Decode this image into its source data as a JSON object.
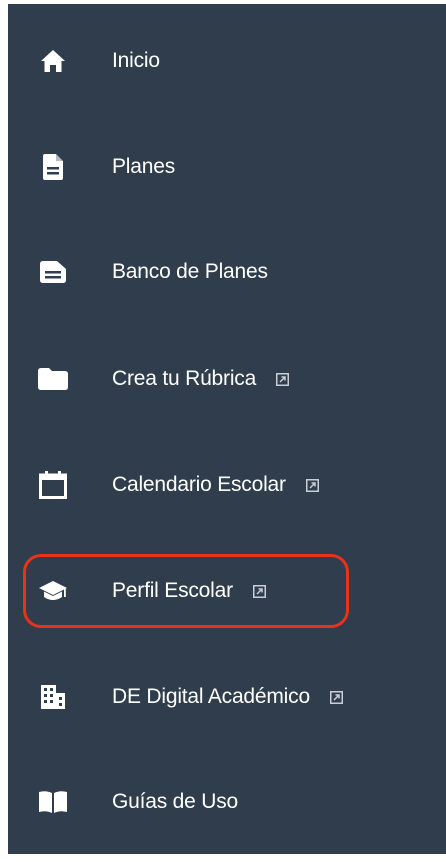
{
  "sidebar": {
    "items": [
      {
        "label": "Inicio",
        "icon": "home-icon",
        "external": false
      },
      {
        "label": "Planes",
        "icon": "document-icon",
        "external": false
      },
      {
        "label": "Banco de Planes",
        "icon": "document-icon",
        "external": false
      },
      {
        "label": "Crea tu Rúbrica",
        "icon": "folder-icon",
        "external": true
      },
      {
        "label": "Calendario Escolar",
        "icon": "calendar-icon",
        "external": true
      },
      {
        "label": "Perfil Escolar",
        "icon": "graduation-cap-icon",
        "external": true,
        "highlighted": true
      },
      {
        "label": "DE Digital Académico",
        "icon": "building-icon",
        "external": true
      },
      {
        "label": "Guías de Uso",
        "icon": "book-icon",
        "external": false
      }
    ]
  },
  "colors": {
    "sidebar_background": "#2f3d4c",
    "text": "#ffffff",
    "highlight_outline": "#e8321c"
  }
}
